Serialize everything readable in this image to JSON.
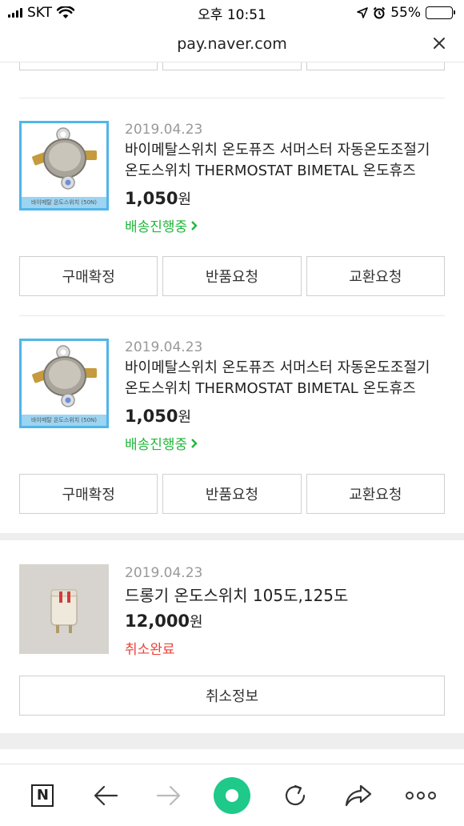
{
  "status_bar": {
    "carrier": "SKT",
    "time": "오후 10:51",
    "battery": "55%",
    "battery_level": 0.55
  },
  "url_bar": {
    "url": "pay.naver.com"
  },
  "orders": [
    {
      "date": "2019.04.23",
      "title": "바이메탈스위치 온도퓨즈 서머스터 자동온도조절기 온도스위치 THERMOSTAT BIMETAL 온도휴즈",
      "price": "1,050",
      "currency": "원",
      "status": "배송진행중",
      "thumb_caption": "바이메탈 온도스위치 (50N)",
      "buttons": [
        "구매확정",
        "반품요청",
        "교환요청"
      ]
    },
    {
      "date": "2019.04.23",
      "title": "바이메탈스위치 온도퓨즈 서머스터 자동온도조절기 온도스위치 THERMOSTAT BIMETAL 온도휴즈",
      "price": "1,050",
      "currency": "원",
      "status": "배송진행중",
      "thumb_caption": "바이메탈 온도스위치 (50N)",
      "buttons": [
        "구매확정",
        "반품요청",
        "교환요청"
      ]
    },
    {
      "date": "2019.04.23",
      "title": "드롱기 온도스위치 105도,125도",
      "price": "12,000",
      "currency": "원",
      "status": "취소완료",
      "button": "취소정보"
    }
  ],
  "toolbar": {
    "naver_logo": "N",
    "icons": [
      "naver-home-icon",
      "back-arrow-icon",
      "forward-arrow-icon",
      "green-dot-icon",
      "reload-icon",
      "share-icon",
      "more-icon"
    ]
  },
  "colors": {
    "shipping_status": "#1fb83a",
    "cancel_status": "#e8443a",
    "thumb_border": "#4fb6e9",
    "home_button": "#1ec98a"
  }
}
